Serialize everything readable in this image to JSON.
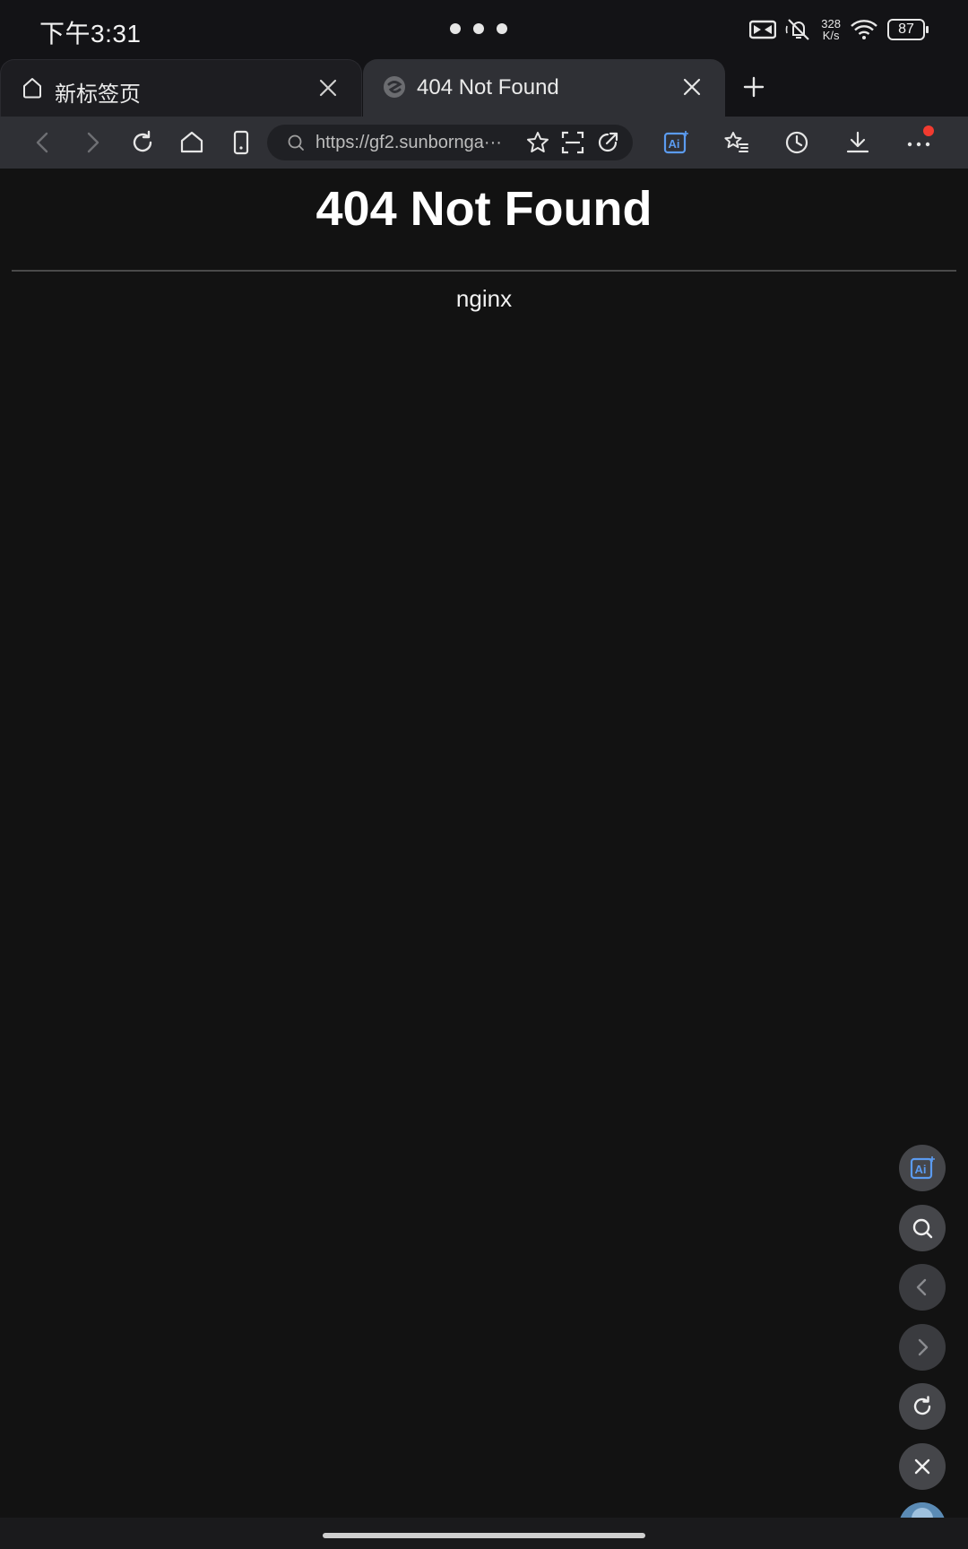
{
  "status_bar": {
    "time": "下午3:31",
    "net_speed_value": "328",
    "net_speed_unit": "K/s",
    "battery": "87"
  },
  "tabs": [
    {
      "title": "新标签页",
      "icon": "home-icon",
      "active": false
    },
    {
      "title": "404 Not Found",
      "icon": "browser-logo-icon",
      "active": true
    }
  ],
  "toolbar": {
    "url": "https://gf2.sunbornga···"
  },
  "page": {
    "heading": "404 Not Found",
    "footer": "nginx"
  },
  "floating_buttons": [
    "ai-assistant-icon",
    "search-icon",
    "back-icon",
    "forward-icon",
    "refresh-icon",
    "close-icon",
    "avatar-icon"
  ],
  "colors": {
    "background": "#121212",
    "toolbar": "#2f3035",
    "ai_accent": "#5b9bf0",
    "notification_dot": "#f23b30"
  }
}
